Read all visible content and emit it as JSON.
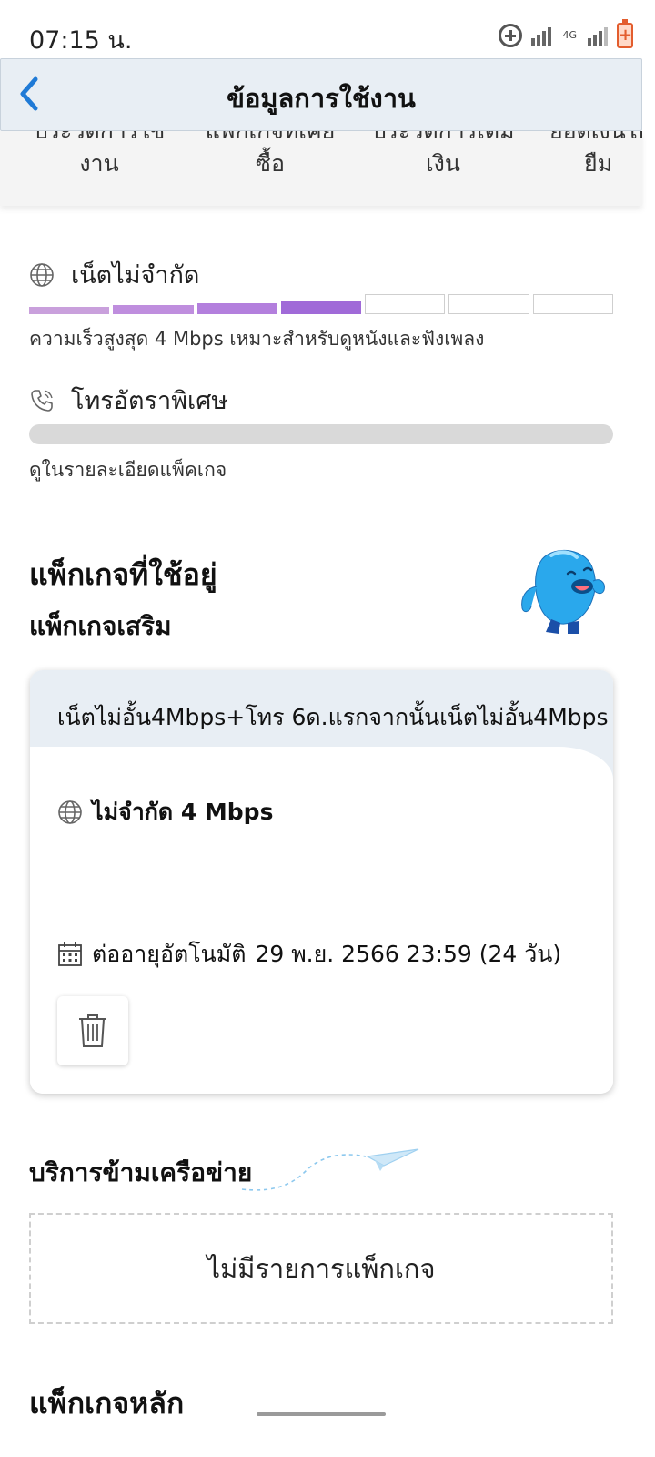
{
  "status_bar": {
    "time": "07:15 น.",
    "network_badge": "4G",
    "battery_symbol": "+"
  },
  "header": {
    "title": "ข้อมูลการใช้งาน",
    "back_icon": "chevron-left-icon"
  },
  "tabs": [
    {
      "line1": "ประวัติการใช้",
      "line2": "งาน"
    },
    {
      "line1": "แพ็กเกจที่เคย",
      "line2": "ซื้อ"
    },
    {
      "line1": "ประวัติการเติม",
      "line2": "เงิน"
    },
    {
      "line1": "ยอดเงินให้",
      "line2": "ยืม"
    }
  ],
  "usage": {
    "internet": {
      "label": "เน็ตไม่จำกัด",
      "icon": "globe-icon",
      "description": "ความเร็วสูงสุด 4 Mbps เหมาะสำหรับดูหนังและฟังเพลง",
      "level": 4,
      "max_level": 7
    },
    "calls": {
      "label": "โทรอัตราพิเศษ",
      "icon": "phone-icon",
      "description": "ดูในรายละเอียดแพ็คเกจ"
    }
  },
  "packages": {
    "title": "แพ็กเกจที่ใช้อยู่",
    "addon_title": "แพ็กเกจเสริม",
    "addon": {
      "name": "เน็ตไม่อั้น4Mbps+โทร 6ด.แรกจากนั้นเน็ตไม่อั้น4Mbps",
      "data_label": "ไม่จำกัด 4 Mbps",
      "renew_label": "ต่ออายุอัตโนมัติ",
      "renew_date": "29 พ.ย. 2566 23:59 (24 วัน)",
      "delete_icon": "trash-icon"
    },
    "main_title": "แพ็กเกจหลัก"
  },
  "roaming": {
    "title": "บริการข้ามเครือข่าย",
    "empty_text": "ไม่มีรายการแพ็กเกจ"
  },
  "colors": {
    "accent_blue": "#1f7ad6",
    "segment_filled": [
      "#c9a0dc",
      "#bf8ede",
      "#b37fdd",
      "#a06ad8"
    ],
    "header_bg": "#e8eef4"
  }
}
